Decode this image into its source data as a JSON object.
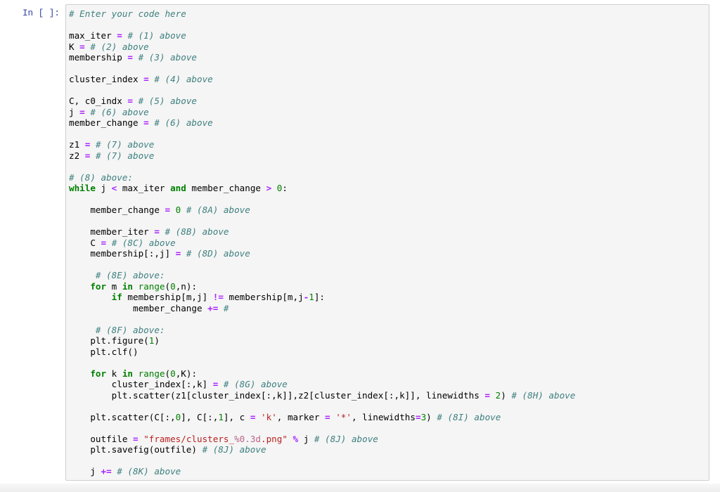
{
  "prompt": {
    "label": "In [ ]:"
  },
  "cell": {
    "language": "python",
    "lines": [
      [
        {
          "t": "cm",
          "v": "# Enter your code here"
        }
      ],
      [],
      [
        {
          "t": "tx",
          "v": "max_iter "
        },
        {
          "t": "op",
          "v": "="
        },
        {
          "t": "tx",
          "v": " "
        },
        {
          "t": "cm",
          "v": "# (1) above"
        }
      ],
      [
        {
          "t": "tx",
          "v": "K "
        },
        {
          "t": "op",
          "v": "="
        },
        {
          "t": "tx",
          "v": " "
        },
        {
          "t": "cm",
          "v": "# (2) above"
        }
      ],
      [
        {
          "t": "tx",
          "v": "membership "
        },
        {
          "t": "op",
          "v": "="
        },
        {
          "t": "tx",
          "v": " "
        },
        {
          "t": "cm",
          "v": "# (3) above"
        }
      ],
      [],
      [
        {
          "t": "tx",
          "v": "cluster_index "
        },
        {
          "t": "op",
          "v": "="
        },
        {
          "t": "tx",
          "v": " "
        },
        {
          "t": "cm",
          "v": "# (4) above"
        }
      ],
      [],
      [
        {
          "t": "tx",
          "v": "C, c0_indx "
        },
        {
          "t": "op",
          "v": "="
        },
        {
          "t": "tx",
          "v": " "
        },
        {
          "t": "cm",
          "v": "# (5) above"
        }
      ],
      [
        {
          "t": "tx",
          "v": "j "
        },
        {
          "t": "op",
          "v": "="
        },
        {
          "t": "tx",
          "v": " "
        },
        {
          "t": "cm",
          "v": "# (6) above"
        }
      ],
      [
        {
          "t": "tx",
          "v": "member_change "
        },
        {
          "t": "op",
          "v": "="
        },
        {
          "t": "tx",
          "v": " "
        },
        {
          "t": "cm",
          "v": "# (6) above"
        }
      ],
      [],
      [
        {
          "t": "tx",
          "v": "z1 "
        },
        {
          "t": "op",
          "v": "="
        },
        {
          "t": "tx",
          "v": " "
        },
        {
          "t": "cm",
          "v": "# (7) above"
        }
      ],
      [
        {
          "t": "tx",
          "v": "z2 "
        },
        {
          "t": "op",
          "v": "="
        },
        {
          "t": "tx",
          "v": " "
        },
        {
          "t": "cm",
          "v": "# (7) above"
        }
      ],
      [],
      [
        {
          "t": "cm",
          "v": "# (8) above:"
        }
      ],
      [
        {
          "t": "kw",
          "v": "while"
        },
        {
          "t": "tx",
          "v": " j "
        },
        {
          "t": "op",
          "v": "<"
        },
        {
          "t": "tx",
          "v": " max_iter "
        },
        {
          "t": "kw",
          "v": "and"
        },
        {
          "t": "tx",
          "v": " member_change "
        },
        {
          "t": "op",
          "v": ">"
        },
        {
          "t": "tx",
          "v": " "
        },
        {
          "t": "num",
          "v": "0"
        },
        {
          "t": "tx",
          "v": ":"
        }
      ],
      [],
      [
        {
          "t": "tx",
          "v": "    member_change "
        },
        {
          "t": "op",
          "v": "="
        },
        {
          "t": "tx",
          "v": " "
        },
        {
          "t": "num",
          "v": "0"
        },
        {
          "t": "tx",
          "v": " "
        },
        {
          "t": "cm",
          "v": "# (8A) above"
        }
      ],
      [],
      [
        {
          "t": "tx",
          "v": "    member_iter "
        },
        {
          "t": "op",
          "v": "="
        },
        {
          "t": "tx",
          "v": " "
        },
        {
          "t": "cm",
          "v": "# (8B) above"
        }
      ],
      [
        {
          "t": "tx",
          "v": "    C "
        },
        {
          "t": "op",
          "v": "="
        },
        {
          "t": "tx",
          "v": " "
        },
        {
          "t": "cm",
          "v": "# (8C) above"
        }
      ],
      [
        {
          "t": "tx",
          "v": "    membership[:,j] "
        },
        {
          "t": "op",
          "v": "="
        },
        {
          "t": "tx",
          "v": " "
        },
        {
          "t": "cm",
          "v": "# (8D) above"
        }
      ],
      [],
      [
        {
          "t": "tx",
          "v": "     "
        },
        {
          "t": "cm",
          "v": "# (8E) above:"
        }
      ],
      [
        {
          "t": "tx",
          "v": "    "
        },
        {
          "t": "kw",
          "v": "for"
        },
        {
          "t": "tx",
          "v": " m "
        },
        {
          "t": "kw",
          "v": "in"
        },
        {
          "t": "tx",
          "v": " "
        },
        {
          "t": "bi",
          "v": "range"
        },
        {
          "t": "tx",
          "v": "("
        },
        {
          "t": "num",
          "v": "0"
        },
        {
          "t": "tx",
          "v": ",n):"
        }
      ],
      [
        {
          "t": "tx",
          "v": "        "
        },
        {
          "t": "kw",
          "v": "if"
        },
        {
          "t": "tx",
          "v": " membership[m,j] "
        },
        {
          "t": "op",
          "v": "!="
        },
        {
          "t": "tx",
          "v": " membership[m,j"
        },
        {
          "t": "op",
          "v": "-"
        },
        {
          "t": "num",
          "v": "1"
        },
        {
          "t": "tx",
          "v": "]:"
        }
      ],
      [
        {
          "t": "tx",
          "v": "            member_change "
        },
        {
          "t": "op",
          "v": "+="
        },
        {
          "t": "tx",
          "v": " "
        },
        {
          "t": "cm",
          "v": "#"
        }
      ],
      [],
      [
        {
          "t": "tx",
          "v": "     "
        },
        {
          "t": "cm",
          "v": "# (8F) above:"
        }
      ],
      [
        {
          "t": "tx",
          "v": "    plt.figure("
        },
        {
          "t": "num",
          "v": "1"
        },
        {
          "t": "tx",
          "v": ")"
        }
      ],
      [
        {
          "t": "tx",
          "v": "    plt.clf()"
        }
      ],
      [],
      [
        {
          "t": "tx",
          "v": "    "
        },
        {
          "t": "kw",
          "v": "for"
        },
        {
          "t": "tx",
          "v": " k "
        },
        {
          "t": "kw",
          "v": "in"
        },
        {
          "t": "tx",
          "v": " "
        },
        {
          "t": "bi",
          "v": "range"
        },
        {
          "t": "tx",
          "v": "("
        },
        {
          "t": "num",
          "v": "0"
        },
        {
          "t": "tx",
          "v": ",K):"
        }
      ],
      [
        {
          "t": "tx",
          "v": "        cluster_index[:,k] "
        },
        {
          "t": "op",
          "v": "="
        },
        {
          "t": "tx",
          "v": " "
        },
        {
          "t": "cm",
          "v": "# (8G) above"
        }
      ],
      [
        {
          "t": "tx",
          "v": "        plt.scatter(z1[cluster_index[:,k]],z2[cluster_index[:,k]], linewidths "
        },
        {
          "t": "op",
          "v": "="
        },
        {
          "t": "tx",
          "v": " "
        },
        {
          "t": "num",
          "v": "2"
        },
        {
          "t": "tx",
          "v": ") "
        },
        {
          "t": "cm",
          "v": "# (8H) above"
        }
      ],
      [],
      [
        {
          "t": "tx",
          "v": "    plt.scatter(C[:,"
        },
        {
          "t": "num",
          "v": "0"
        },
        {
          "t": "tx",
          "v": "], C[:,"
        },
        {
          "t": "num",
          "v": "1"
        },
        {
          "t": "tx",
          "v": "], c "
        },
        {
          "t": "op",
          "v": "="
        },
        {
          "t": "tx",
          "v": " "
        },
        {
          "t": "str",
          "v": "'k'"
        },
        {
          "t": "tx",
          "v": ", marker "
        },
        {
          "t": "op",
          "v": "="
        },
        {
          "t": "tx",
          "v": " "
        },
        {
          "t": "str",
          "v": "'*'"
        },
        {
          "t": "tx",
          "v": ", linewidths"
        },
        {
          "t": "op",
          "v": "="
        },
        {
          "t": "num",
          "v": "3"
        },
        {
          "t": "tx",
          "v": ") "
        },
        {
          "t": "cm",
          "v": "# (8I) above"
        }
      ],
      [],
      [
        {
          "t": "tx",
          "v": "    outfile "
        },
        {
          "t": "op",
          "v": "="
        },
        {
          "t": "tx",
          "v": " "
        },
        {
          "t": "str",
          "v": "\"frames/clusters_"
        },
        {
          "t": "sp",
          "v": "%0.3d"
        },
        {
          "t": "str",
          "v": ".png\""
        },
        {
          "t": "tx",
          "v": " "
        },
        {
          "t": "op",
          "v": "%"
        },
        {
          "t": "tx",
          "v": " j "
        },
        {
          "t": "cm",
          "v": "# (8J) above"
        }
      ],
      [
        {
          "t": "tx",
          "v": "    plt.savefig(outfile) "
        },
        {
          "t": "cm",
          "v": "# (8J) above"
        }
      ],
      [],
      [
        {
          "t": "tx",
          "v": "    j "
        },
        {
          "t": "op",
          "v": "+="
        },
        {
          "t": "tx",
          "v": " "
        },
        {
          "t": "cm",
          "v": "# (8K) above"
        }
      ]
    ]
  }
}
